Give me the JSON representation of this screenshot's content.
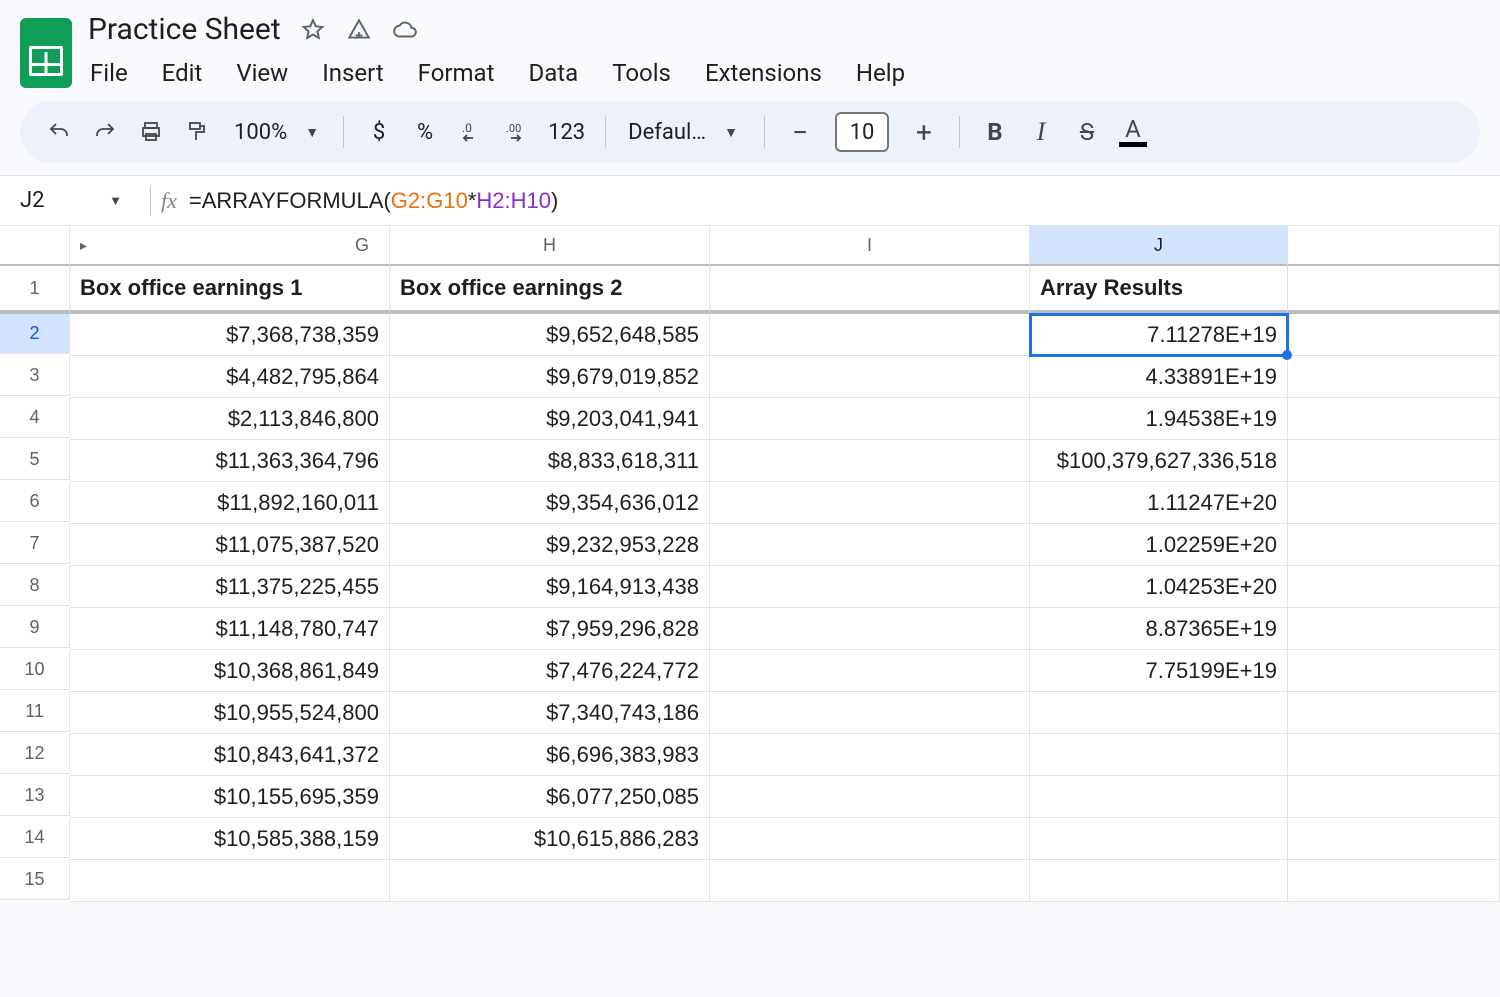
{
  "doc": {
    "title": "Practice Sheet"
  },
  "menus": [
    "File",
    "Edit",
    "View",
    "Insert",
    "Format",
    "Data",
    "Tools",
    "Extensions",
    "Help"
  ],
  "toolbar": {
    "zoom": "100%",
    "font": "Defaul…",
    "size": "10",
    "number_123": "123"
  },
  "namebox": "J2",
  "formula": {
    "prefix": "=ARRAYFORMULA(",
    "range1": "G2:G10",
    "op": "*",
    "range2": "H2:H10",
    "suffix": ")"
  },
  "columns": {
    "G": "G",
    "H": "H",
    "I": "I",
    "J": "J"
  },
  "headers": {
    "G": "Box office earnings 1",
    "H": "Box office earnings 2",
    "I": "",
    "J": "Array Results"
  },
  "rows": [
    {
      "n": "1"
    },
    {
      "n": "2",
      "G": "$7,368,738,359",
      "H": "$9,652,648,585",
      "J": "7.11278E+19"
    },
    {
      "n": "3",
      "G": "$4,482,795,864",
      "H": "$9,679,019,852",
      "J": "4.33891E+19"
    },
    {
      "n": "4",
      "G": "$2,113,846,800",
      "H": "$9,203,041,941",
      "J": "1.94538E+19"
    },
    {
      "n": "5",
      "G": "$11,363,364,796",
      "H": "$8,833,618,311",
      "J": "$100,379,627,336,518"
    },
    {
      "n": "6",
      "G": "$11,892,160,011",
      "H": "$9,354,636,012",
      "J": "1.11247E+20"
    },
    {
      "n": "7",
      "G": "$11,075,387,520",
      "H": "$9,232,953,228",
      "J": "1.02259E+20"
    },
    {
      "n": "8",
      "G": "$11,375,225,455",
      "H": "$9,164,913,438",
      "J": "1.04253E+20"
    },
    {
      "n": "9",
      "G": "$11,148,780,747",
      "H": "$7,959,296,828",
      "J": "8.87365E+19"
    },
    {
      "n": "10",
      "G": "$10,368,861,849",
      "H": "$7,476,224,772",
      "J": "7.75199E+19"
    },
    {
      "n": "11",
      "G": "$10,955,524,800",
      "H": "$7,340,743,186",
      "J": ""
    },
    {
      "n": "12",
      "G": "$10,843,641,372",
      "H": "$6,696,383,983",
      "J": ""
    },
    {
      "n": "13",
      "G": "$10,155,695,359",
      "H": "$6,077,250,085",
      "J": ""
    },
    {
      "n": "14",
      "G": "$10,585,388,159",
      "H": "$10,615,886,283",
      "J": ""
    },
    {
      "n": "15",
      "G": "",
      "H": "",
      "J": ""
    }
  ]
}
